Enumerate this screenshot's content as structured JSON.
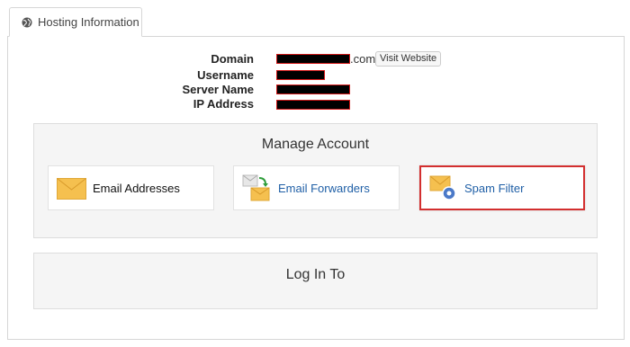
{
  "tab": {
    "label": "Hosting Information",
    "icon": "globe-icon"
  },
  "info": {
    "domain_label": "Domain",
    "domain_suffix": ".com",
    "visit_button": "Visit Website",
    "username_label": "Username",
    "server_label": "Server Name",
    "ip_label": "IP Address"
  },
  "manage": {
    "title": "Manage Account",
    "tiles": [
      {
        "label": "Email Addresses",
        "icon": "envelope-icon"
      },
      {
        "label": "Email Forwarders",
        "icon": "email-forward-icon"
      },
      {
        "label": "Spam Filter",
        "icon": "spam-filter-icon"
      }
    ]
  },
  "login": {
    "title": "Log In To"
  },
  "colors": {
    "link": "#1f5fa6",
    "highlight": "#d32f2f",
    "envelope": "#f5c04f"
  }
}
